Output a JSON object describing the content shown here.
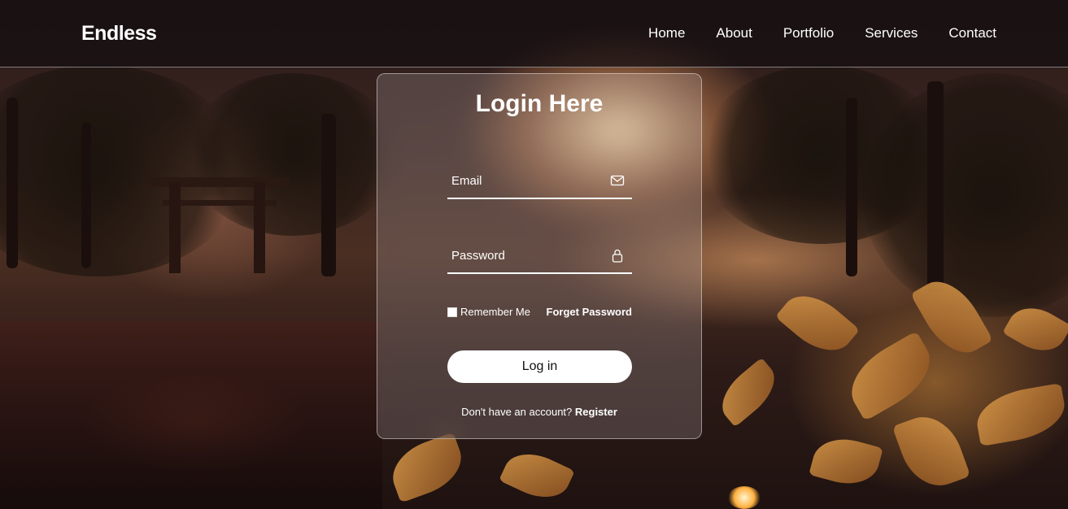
{
  "header": {
    "logo": "Endless",
    "nav": [
      "Home",
      "About",
      "Portfolio",
      "Services",
      "Contact"
    ]
  },
  "login": {
    "title": "Login Here",
    "email_placeholder": "Email",
    "email_icon": "envelope-icon",
    "password_placeholder": "Password",
    "password_icon": "lock-icon",
    "remember_label": "Remember Me",
    "remember_checked": false,
    "forget_label": "Forget Password",
    "login_button": "Log in",
    "register_prompt": "Don't have an account?",
    "register_link": "Register"
  },
  "colors": {
    "text": "#ffffff",
    "button_bg": "#ffffff",
    "button_text": "#111111"
  }
}
